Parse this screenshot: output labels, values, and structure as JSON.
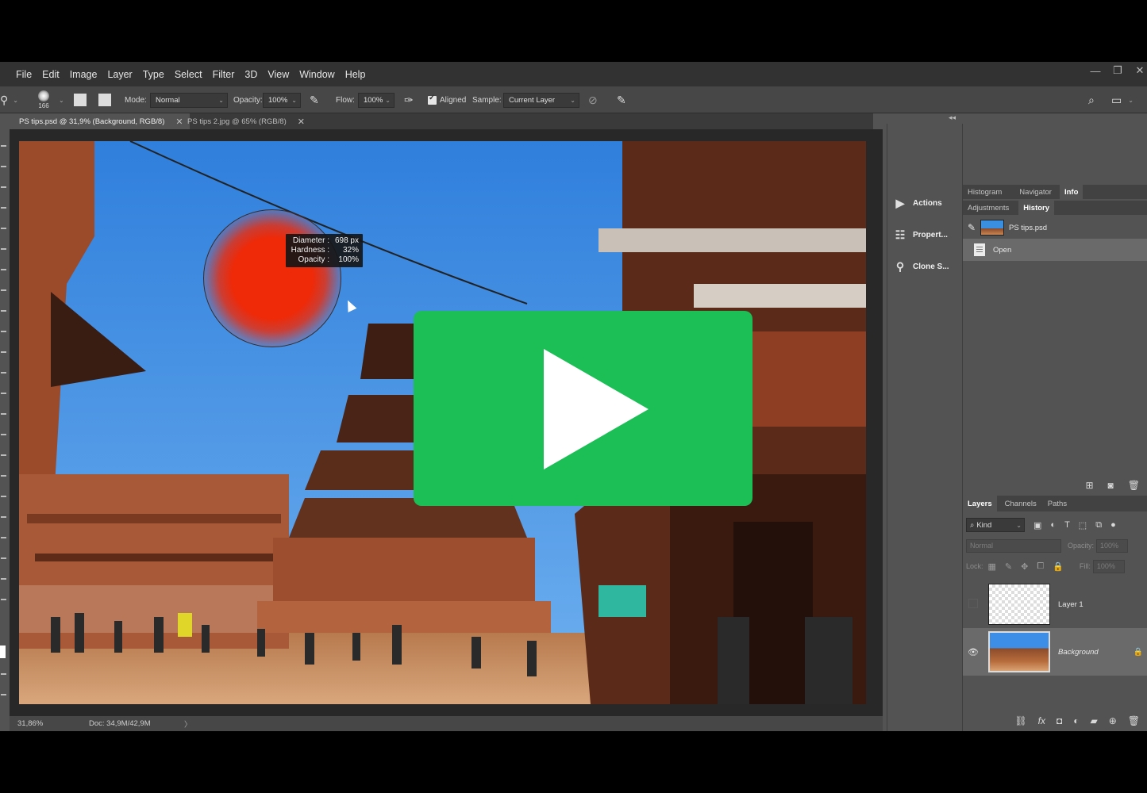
{
  "menubar": {
    "items": [
      "File",
      "Edit",
      "Image",
      "Layer",
      "Type",
      "Select",
      "Filter",
      "3D",
      "View",
      "Window",
      "Help"
    ],
    "window_controls": [
      "minimize-icon",
      "restore-icon",
      "close-icon"
    ]
  },
  "options": {
    "brush_size": "166",
    "mode_label": "Mode:",
    "mode_value": "Normal",
    "opacity_label": "Opacity:",
    "opacity_value": "100%",
    "flow_label": "Flow:",
    "flow_value": "100%",
    "aligned_label": "Aligned",
    "sample_label": "Sample:",
    "sample_value": "Current Layer"
  },
  "tabs": [
    {
      "label": "PS tips.psd @ 31,9% (Background, RGB/8)",
      "active": true
    },
    {
      "label": "PS tips 2.jpg @ 65% (RGB/8)",
      "active": false
    }
  ],
  "brush_tooltip": {
    "diameter_label": "Diameter :",
    "diameter_value": "698 px",
    "hardness_label": "Hardness :",
    "hardness_value": "32%",
    "opacity_label": "Opacity :",
    "opacity_value": "100%"
  },
  "status": {
    "zoom": "31,86%",
    "doc": "Doc: 34,9M/42,9M",
    "caret": "〉"
  },
  "mid_panel": {
    "items": [
      {
        "label": "Actions",
        "icon": "play-icon"
      },
      {
        "label": "Propert...",
        "icon": "properties-icon"
      },
      {
        "label": "Clone S...",
        "icon": "clone-source-icon"
      }
    ]
  },
  "top_panel": {
    "tabs_row1": [
      "Histogram",
      "Navigator",
      "Info"
    ],
    "tabs_row2": [
      "Adjustments",
      "History"
    ],
    "history": [
      {
        "label": "PS tips.psd"
      },
      {
        "label": "Open"
      }
    ]
  },
  "layers_panel": {
    "tabs": [
      "Layers",
      "Channels",
      "Paths"
    ],
    "kind_label": "Kind",
    "blend_value": "Normal",
    "opacity_label": "Opacity:",
    "opacity_value": "100%",
    "lock_label": "Lock:",
    "fill_label": "Fill:",
    "fill_value": "100%",
    "layers": [
      {
        "name": "Layer 1",
        "visible": false,
        "selected": false
      },
      {
        "name": "Background",
        "visible": true,
        "selected": true
      }
    ]
  },
  "colors": {
    "accent_play": "#1bbf55",
    "brush_red": "#ee2a08",
    "panel_bg": "#535353",
    "menubar_bg": "#323232"
  }
}
